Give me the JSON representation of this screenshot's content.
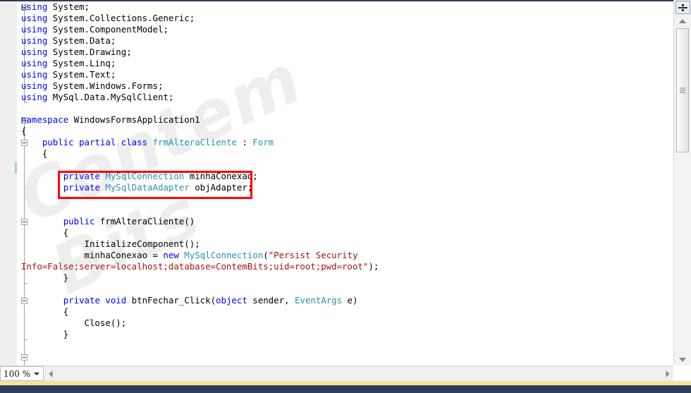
{
  "editor": {
    "watermark_text": "Contem Bits",
    "language": "csharp",
    "colors": {
      "keyword": "#0000FF",
      "type": "#2B91AF",
      "string": "#A31515",
      "plain": "#000000",
      "annotation_box": "#FF0000",
      "background": "#FFFFFF",
      "indicator_margin": "#EFEFF0"
    },
    "lines": [
      [
        {
          "t": "using",
          "c": "kw"
        },
        {
          "t": " System;",
          "c": "plain"
        }
      ],
      [
        {
          "t": "using",
          "c": "kw"
        },
        {
          "t": " System.Collections.Generic;",
          "c": "plain"
        }
      ],
      [
        {
          "t": "using",
          "c": "kw"
        },
        {
          "t": " System.ComponentModel;",
          "c": "plain"
        }
      ],
      [
        {
          "t": "using",
          "c": "kw"
        },
        {
          "t": " System.Data;",
          "c": "plain"
        }
      ],
      [
        {
          "t": "using",
          "c": "kw"
        },
        {
          "t": " System.Drawing;",
          "c": "plain"
        }
      ],
      [
        {
          "t": "using",
          "c": "kw"
        },
        {
          "t": " System.Linq;",
          "c": "plain"
        }
      ],
      [
        {
          "t": "using",
          "c": "kw"
        },
        {
          "t": " System.Text;",
          "c": "plain"
        }
      ],
      [
        {
          "t": "using",
          "c": "kw"
        },
        {
          "t": " System.Windows.Forms;",
          "c": "plain"
        }
      ],
      [
        {
          "t": "using",
          "c": "kw"
        },
        {
          "t": " MySql.Data.MySqlClient;",
          "c": "plain"
        }
      ],
      [],
      [
        {
          "t": "namespace",
          "c": "kw"
        },
        {
          "t": " WindowsFormsApplication1",
          "c": "plain"
        }
      ],
      [
        {
          "t": "{",
          "c": "plain"
        }
      ],
      [
        {
          "t": "    ",
          "c": "plain"
        },
        {
          "t": "public",
          "c": "kw"
        },
        {
          "t": " ",
          "c": "plain"
        },
        {
          "t": "partial",
          "c": "kw"
        },
        {
          "t": " ",
          "c": "plain"
        },
        {
          "t": "class",
          "c": "kw"
        },
        {
          "t": " ",
          "c": "plain"
        },
        {
          "t": "frmAlteraCliente",
          "c": "type"
        },
        {
          "t": " : ",
          "c": "plain"
        },
        {
          "t": "Form",
          "c": "type"
        }
      ],
      [
        {
          "t": "    {",
          "c": "plain"
        }
      ],
      [],
      [
        {
          "t": "        ",
          "c": "plain"
        },
        {
          "t": "private",
          "c": "kw"
        },
        {
          "t": " ",
          "c": "plain"
        },
        {
          "t": "MySqlConnection",
          "c": "type"
        },
        {
          "t": " minhaConexao;",
          "c": "plain"
        }
      ],
      [
        {
          "t": "        ",
          "c": "plain"
        },
        {
          "t": "private",
          "c": "kw"
        },
        {
          "t": " ",
          "c": "plain"
        },
        {
          "t": "MySqlDataAdapter",
          "c": "type"
        },
        {
          "t": " objAdapter;",
          "c": "plain"
        }
      ],
      [],
      [],
      [
        {
          "t": "        ",
          "c": "plain"
        },
        {
          "t": "public",
          "c": "kw"
        },
        {
          "t": " frmAlteraCliente()",
          "c": "plain"
        }
      ],
      [
        {
          "t": "        {",
          "c": "plain"
        }
      ],
      [
        {
          "t": "            InitializeComponent();",
          "c": "plain"
        }
      ],
      [
        {
          "t": "            minhaConexao = ",
          "c": "plain"
        },
        {
          "t": "new",
          "c": "kw"
        },
        {
          "t": " ",
          "c": "plain"
        },
        {
          "t": "MySqlConnection",
          "c": "type"
        },
        {
          "t": "(",
          "c": "plain"
        },
        {
          "t": "\"Persist Security ",
          "c": "str"
        }
      ],
      [
        {
          "t": "Info=False;server=localhost;database=ContemBits;uid=root;pwd=root\"",
          "c": "str"
        },
        {
          "t": ");",
          "c": "plain"
        }
      ],
      [
        {
          "t": "        }",
          "c": "plain"
        }
      ],
      [],
      [
        {
          "t": "        ",
          "c": "plain"
        },
        {
          "t": "private",
          "c": "kw"
        },
        {
          "t": " ",
          "c": "plain"
        },
        {
          "t": "void",
          "c": "kw"
        },
        {
          "t": " btnFechar_Click(",
          "c": "plain"
        },
        {
          "t": "object",
          "c": "kw"
        },
        {
          "t": " sender, ",
          "c": "plain"
        },
        {
          "t": "EventArgs",
          "c": "type"
        },
        {
          "t": " e)",
          "c": "plain"
        }
      ],
      [
        {
          "t": "        {",
          "c": "plain"
        }
      ],
      [
        {
          "t": "            Close();",
          "c": "plain"
        }
      ],
      [
        {
          "t": "        }",
          "c": "plain"
        }
      ]
    ]
  },
  "status_bar": {
    "zoom_level": "100 %"
  },
  "icons": {
    "split_view": "split-view-icon",
    "scroll_up": "chevron-up-icon",
    "scroll_down": "chevron-down-icon",
    "scroll_left": "chevron-left-icon",
    "scroll_right": "chevron-right-icon",
    "zoom_dropdown": "chevron-down-icon"
  }
}
